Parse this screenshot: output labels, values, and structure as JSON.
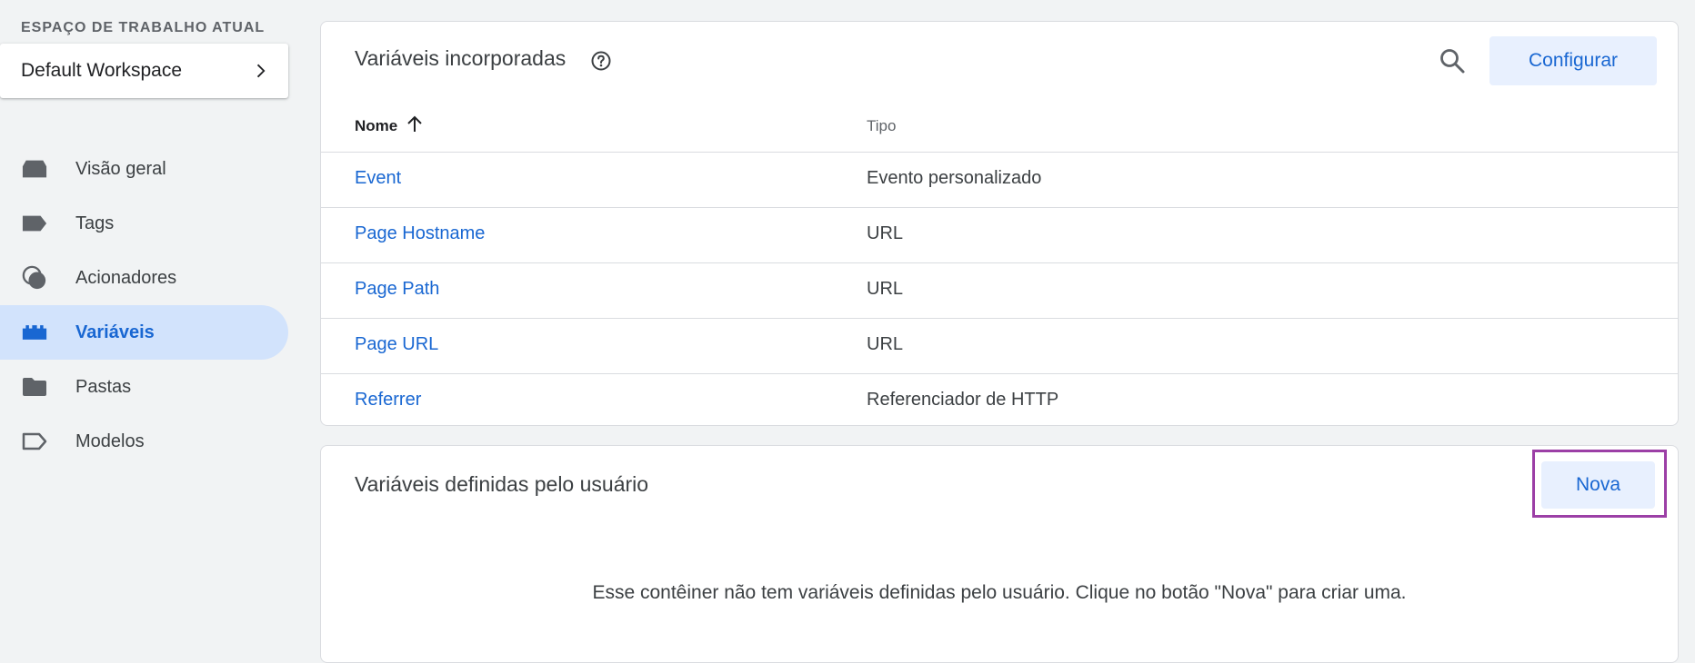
{
  "workspace": {
    "label": "ESPAÇO DE TRABALHO ATUAL",
    "name": "Default Workspace"
  },
  "nav": {
    "items": [
      {
        "label": "Visão geral",
        "icon": "overview-icon"
      },
      {
        "label": "Tags",
        "icon": "tag-icon"
      },
      {
        "label": "Acionadores",
        "icon": "trigger-icon"
      },
      {
        "label": "Variáveis",
        "icon": "variables-icon",
        "active": true
      },
      {
        "label": "Pastas",
        "icon": "folder-icon"
      },
      {
        "label": "Modelos",
        "icon": "template-icon"
      }
    ]
  },
  "builtin": {
    "title": "Variáveis incorporadas",
    "configure_label": "Configurar",
    "columns": {
      "name": "Nome",
      "type": "Tipo"
    },
    "rows": [
      {
        "name": "Event",
        "type": "Evento personalizado"
      },
      {
        "name": "Page Hostname",
        "type": "URL"
      },
      {
        "name": "Page Path",
        "type": "URL"
      },
      {
        "name": "Page URL",
        "type": "URL"
      },
      {
        "name": "Referrer",
        "type": "Referenciador de HTTP"
      }
    ]
  },
  "user_defined": {
    "title": "Variáveis definidas pelo usuário",
    "new_label": "Nova",
    "empty_message": "Esse contêiner não tem variáveis definidas pelo usuário. Clique no botão \"Nova\" para criar uma."
  },
  "colors": {
    "accent": "#1967d2",
    "active_bg": "#d2e3fc",
    "button_bg": "#e8f0fe",
    "highlight": "#9c3fa6"
  }
}
